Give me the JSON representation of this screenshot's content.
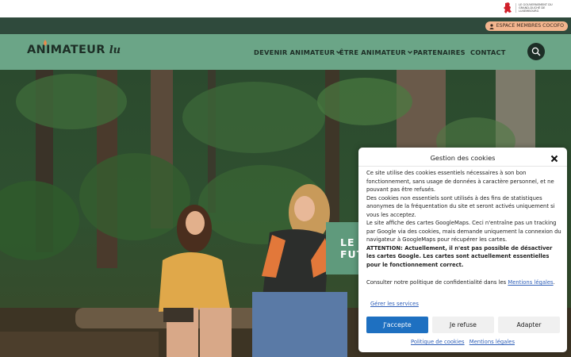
{
  "gov": {
    "text": "Le gouvernement du Grand-Duché de Luxembourg"
  },
  "member_bar": {
    "button_label": "ESPACE MEMBRES COCOFO"
  },
  "logo": {
    "main": "ANIMATEUR",
    "suffix": "lu"
  },
  "nav": {
    "items": [
      {
        "label": "DEVENIR ANIMATEUR",
        "dropdown": true
      },
      {
        "label": "ÊTRE ANIMATEUR",
        "dropdown": true
      },
      {
        "label": "PARTENAIRES",
        "dropdown": false
      },
      {
        "label": "CONTACT",
        "dropdown": false
      }
    ]
  },
  "hero": {
    "title_line1": "LE",
    "title_line2": "FUT"
  },
  "cookie": {
    "title": "Gestion des cookies",
    "para1": "Ce site utilise des cookies essentiels nécessaires à son bon fonctionnement, sans usage de données à caractère personnel, et ne pouvant pas être refusés.",
    "para2": "Des cookies non essentiels sont utilisés à des fins de statistiques anonymes de la fréquentation du site et seront activés uniquement si vous les acceptez.",
    "para3": "Le site affiche des cartes GoogleMaps. Ceci n'entraîne pas un tracking par Google via des cookies, mais demande uniquement la connexion du navigateur à GoogleMaps pour récupérer les cartes.",
    "warning": "ATTENTION: Actuellement, il n'est pas possible de désactiver les cartes Google. Les cartes sont actuellement essentielles pour le fonctionnement correct.",
    "consult_prefix": "Consulter notre politique de confidentialité dans les ",
    "consult_link": "Mentions légales",
    "consult_suffix": ".",
    "manage_label": "Gérer les services",
    "accept_label": "J'accepte",
    "refuse_label": "Je refuse",
    "adapt_label": "Adapter",
    "footer_policy": "Politique de cookies",
    "footer_legal": "Mentions légales"
  },
  "colors": {
    "nav_green": "#6ba587",
    "dark_green": "#2f4a3c",
    "member_button": "#f3b58e",
    "accept_blue": "#1e70c1"
  }
}
